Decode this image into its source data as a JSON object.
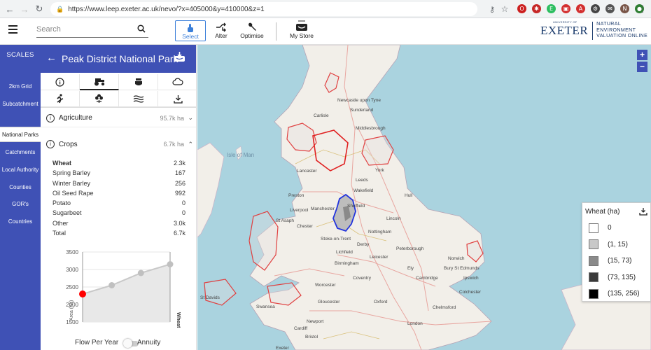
{
  "browser": {
    "url": "https://www.leep.exeter.ac.uk/nevo/?x=405000&y=410000&z=1",
    "extensions": [
      {
        "name": "opera-icon",
        "color": "#cc1f1f",
        "glyph": "O"
      },
      {
        "name": "lastpass-icon",
        "color": "#c62828",
        "glyph": "✱"
      },
      {
        "name": "evernote-icon",
        "color": "#2dbe60",
        "glyph": "E"
      },
      {
        "name": "pdf-icon",
        "color": "#d32f2f",
        "glyph": "▣"
      },
      {
        "name": "adblock-icon",
        "color": "#d32f2f",
        "glyph": "A"
      },
      {
        "name": "gear-extension-icon",
        "color": "#444444",
        "glyph": "⚙"
      },
      {
        "name": "mail-extension-icon",
        "color": "#555555",
        "glyph": "✉"
      },
      {
        "name": "profile-avatar",
        "color": "#795548",
        "glyph": "N"
      },
      {
        "name": "green-extension-icon",
        "color": "#2e7d32",
        "glyph": "●"
      }
    ]
  },
  "header": {
    "search_placeholder": "Search",
    "tools": {
      "select": "Select",
      "alter": "Alter",
      "optimise": "Optimise",
      "store": "My Store"
    },
    "logo_main": "EXETER",
    "logo_top": "UNIVERSITY OF",
    "logo_sub_1": "NATURAL ENVIRONMENT",
    "logo_sub_2": "VALUATION ONLINE"
  },
  "scales": {
    "heading": "SCALES",
    "items": [
      "2km Grid",
      "Subcatchment",
      "National Parks",
      "Catchments",
      "Local Authority",
      "Counties",
      "GOR's",
      "Countries"
    ],
    "active_index": 2
  },
  "panel": {
    "title": "Peak District National Park",
    "agriculture": {
      "label": "Agriculture",
      "value": "95.7k ha"
    },
    "crops": {
      "label": "Crops",
      "value": "6.7k ha"
    },
    "crop_rows": [
      {
        "name": "Wheat",
        "value": "2.3k",
        "bold": true
      },
      {
        "name": "Spring Barley",
        "value": "167"
      },
      {
        "name": "Winter Barley",
        "value": "256"
      },
      {
        "name": "Oil Seed Rape",
        "value": "992"
      },
      {
        "name": "Potato",
        "value": "0"
      },
      {
        "name": "Sugarbeet",
        "value": "0"
      },
      {
        "name": "Other",
        "value": "3.0k"
      },
      {
        "name": "Total",
        "value": "6.7k"
      }
    ],
    "toggle": {
      "left": "Flow Per Year",
      "right": "Annuity"
    }
  },
  "chart_data": {
    "type": "area",
    "x": [
      1,
      2,
      3,
      4
    ],
    "values": [
      2300,
      2550,
      2900,
      3150
    ],
    "highlight_index": 0,
    "highlight_color": "#ff0000",
    "ylim": [
      1500,
      3500
    ],
    "yticks": [
      "3500",
      "3000",
      "2500",
      "2000",
      "1500"
    ],
    "ylabel": "Area (ha)",
    "series_label": "Wheat"
  },
  "map": {
    "labels": [
      {
        "t": "Isle of Man",
        "c": "sea"
      },
      {
        "t": "Newcastle upon Tyne"
      },
      {
        "t": "Sunderland"
      },
      {
        "t": "Middlesbrough"
      },
      {
        "t": "Lancaster"
      },
      {
        "t": "Leeds"
      },
      {
        "t": "Preston"
      },
      {
        "t": "Wakefield"
      },
      {
        "t": "Liverpool"
      },
      {
        "t": "Manchester"
      },
      {
        "t": "Sheffield"
      },
      {
        "t": "Lincoln"
      },
      {
        "t": "Chester"
      },
      {
        "t": "St Asaph"
      },
      {
        "t": "Stoke-on-Trent"
      },
      {
        "t": "Derby"
      },
      {
        "t": "Nottingham"
      },
      {
        "t": "Lichfield"
      },
      {
        "t": "Birmingham"
      },
      {
        "t": "Leicester"
      },
      {
        "t": "Peterborough"
      },
      {
        "t": "Norwich"
      },
      {
        "t": "Coventry"
      },
      {
        "t": "Worcester"
      },
      {
        "t": "Cambridge"
      },
      {
        "t": "Ely"
      },
      {
        "t": "Gloucester"
      },
      {
        "t": "Oxford"
      },
      {
        "t": "Swansea"
      },
      {
        "t": "Cardiff"
      },
      {
        "t": "Newport"
      },
      {
        "t": "Bristol"
      },
      {
        "t": "London"
      },
      {
        "t": "St Davids"
      },
      {
        "t": "Exeter"
      },
      {
        "t": "Carlisle"
      },
      {
        "t": "York"
      },
      {
        "t": "Hull"
      },
      {
        "t": "Colchester"
      },
      {
        "t": "Ipswich"
      },
      {
        "t": "Bury St Edmunds"
      },
      {
        "t": "Chelmsford"
      }
    ]
  },
  "legend": {
    "title": "Wheat (ha)",
    "items": [
      {
        "label": "0",
        "color": "#ffffff"
      },
      {
        "label": "(1, 15)",
        "color": "#c8c8c8"
      },
      {
        "label": "(15, 73)",
        "color": "#8a8a8a"
      },
      {
        "label": "(73, 135)",
        "color": "#3a3a3a"
      },
      {
        "label": "(135, 256)",
        "color": "#000000"
      }
    ]
  }
}
